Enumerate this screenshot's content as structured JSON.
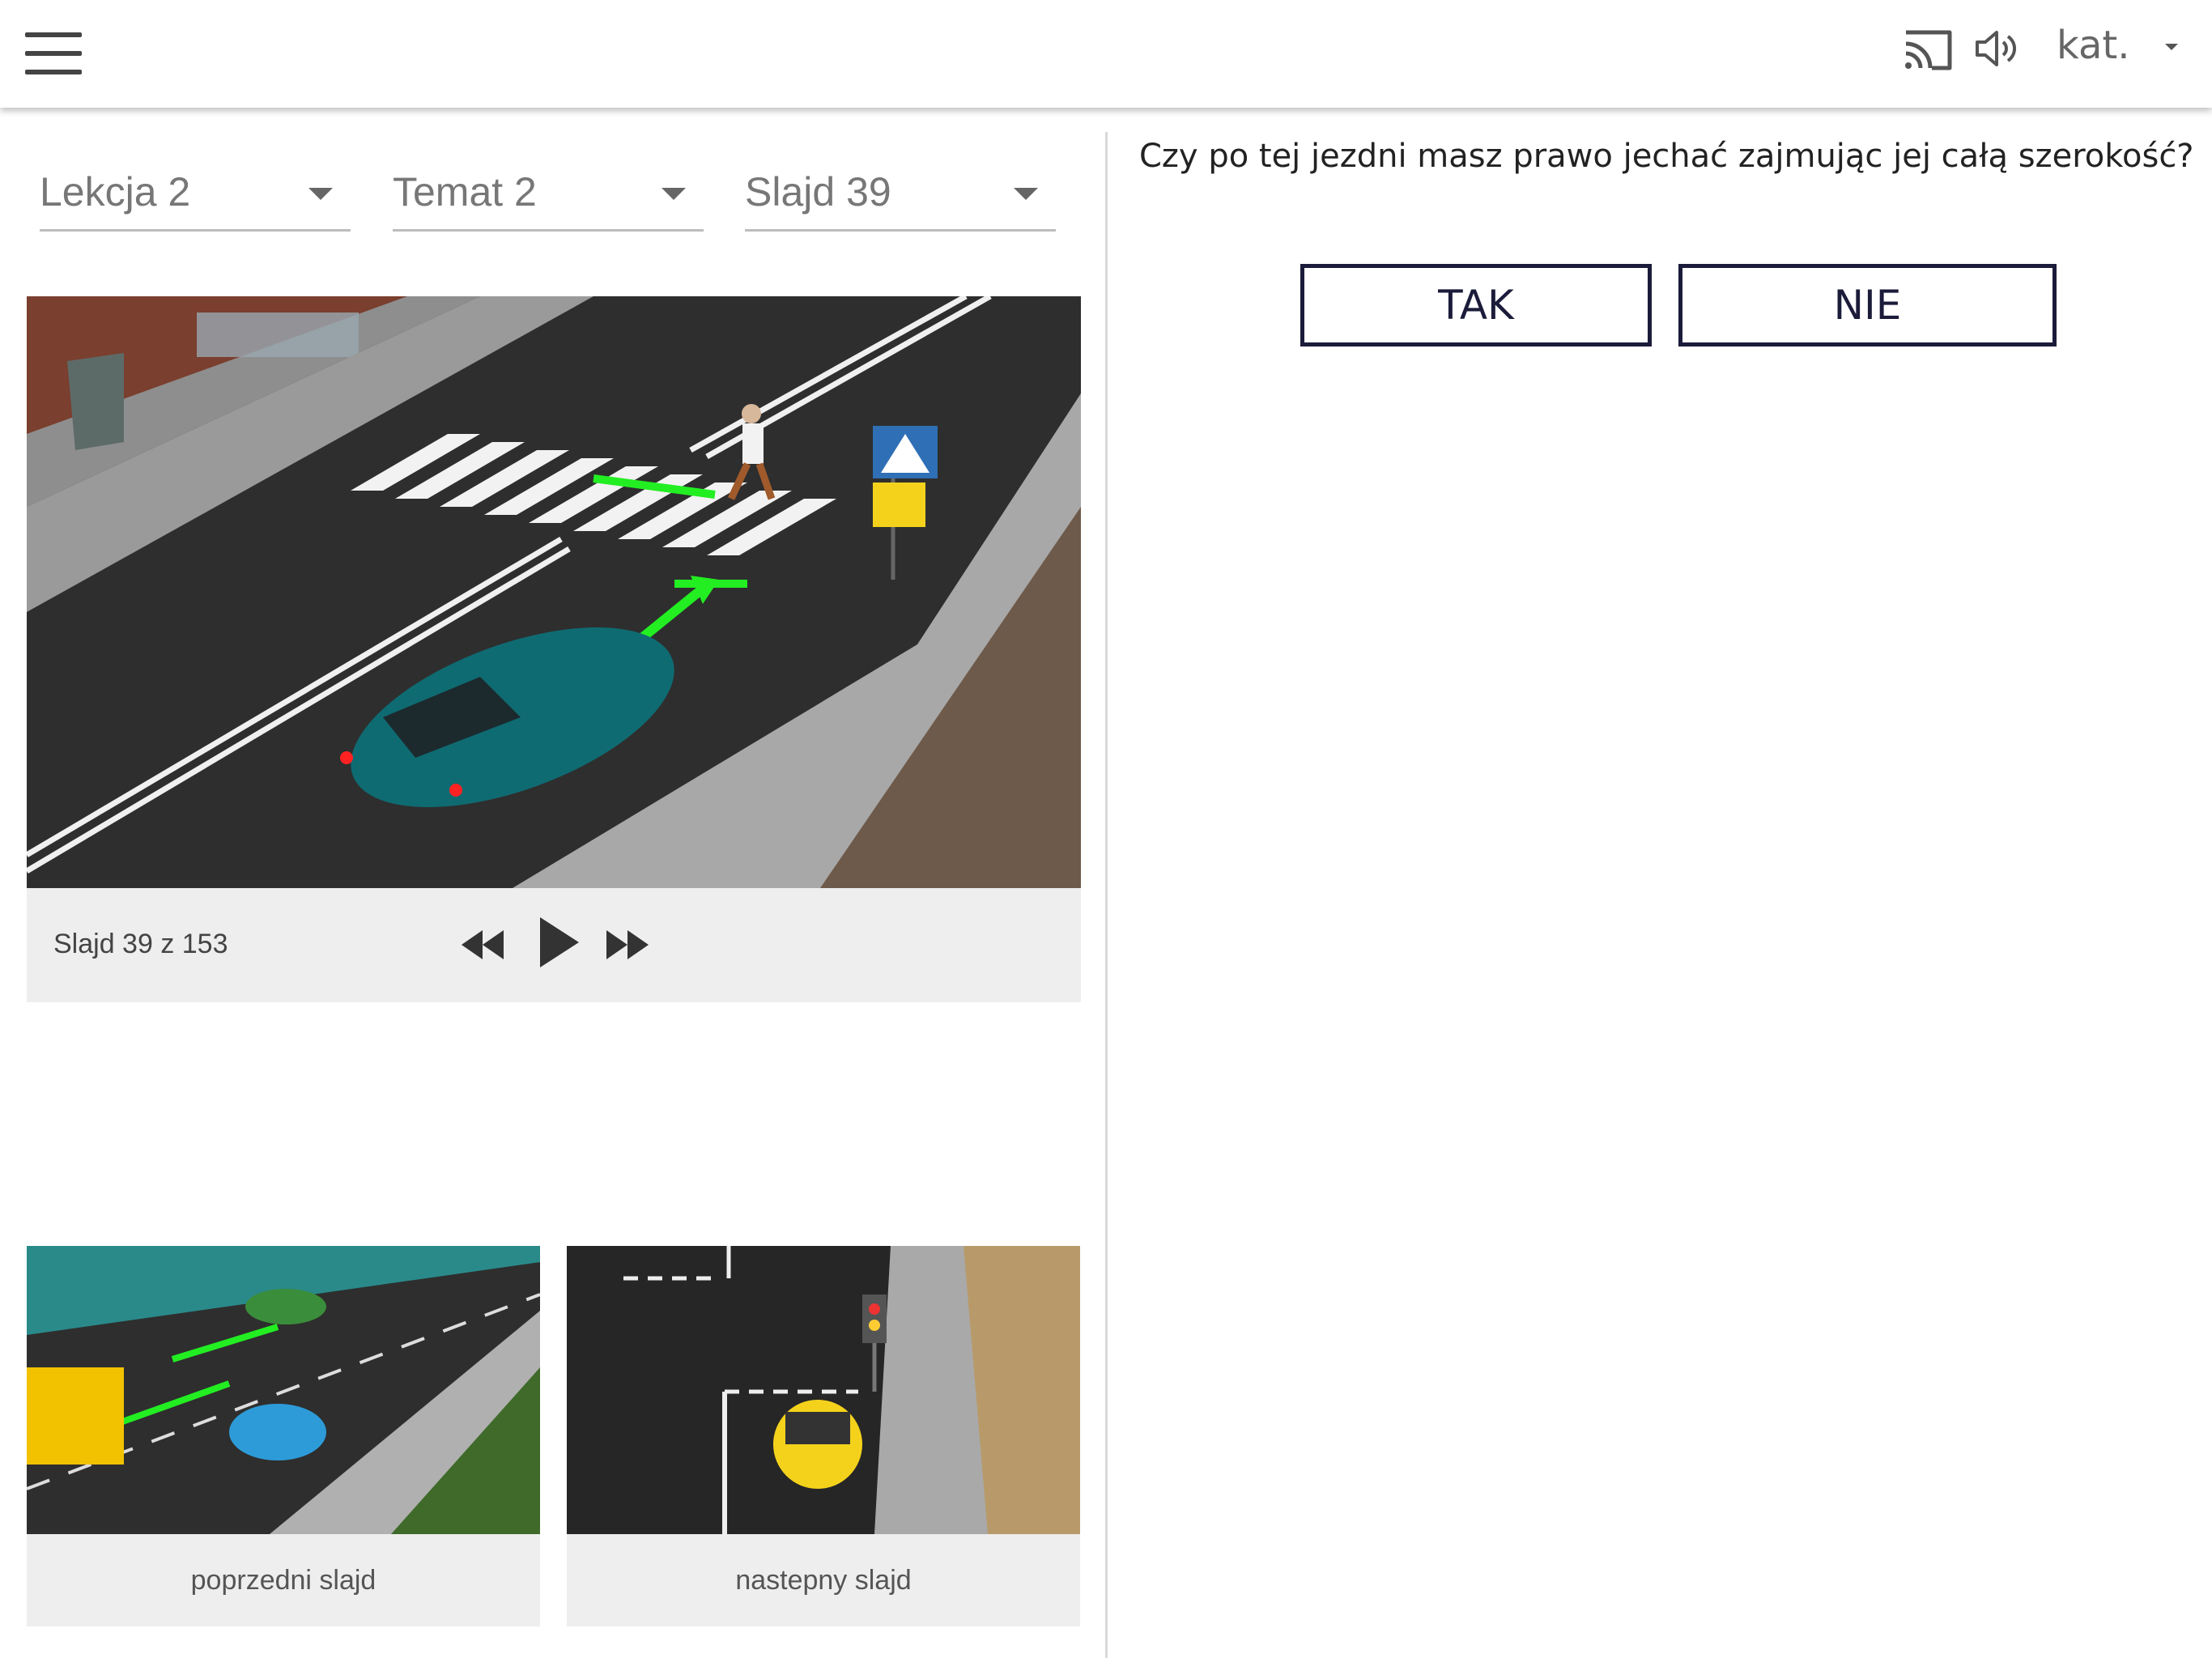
{
  "topbar": {
    "menu_icon": "hamburger-menu-icon",
    "cast_icon": "cast-icon",
    "sound_icon": "volume-icon",
    "category_label": "kat."
  },
  "selectors": {
    "lesson": "Lekcja 2",
    "topic": "Temat 2",
    "slide": "Slajd 39"
  },
  "player": {
    "counter": "Slajd 39 z 153",
    "rewind_icon": "rewind-icon",
    "play_icon": "play-icon",
    "forward_icon": "fast-forward-icon"
  },
  "thumbnails": {
    "prev_label": "poprzedni slajd",
    "next_label": "nastepny slajd"
  },
  "question": {
    "text": "Czy po tej jezdni masz prawo jechać zajmując jej całą szerokość?",
    "answers": [
      "TAK",
      "NIE"
    ]
  },
  "colors": {
    "button_border": "#1b1b3a",
    "player_bg": "#eeeeee",
    "arrow_green": "#22ee22",
    "car_teal": "#0f6b72"
  }
}
